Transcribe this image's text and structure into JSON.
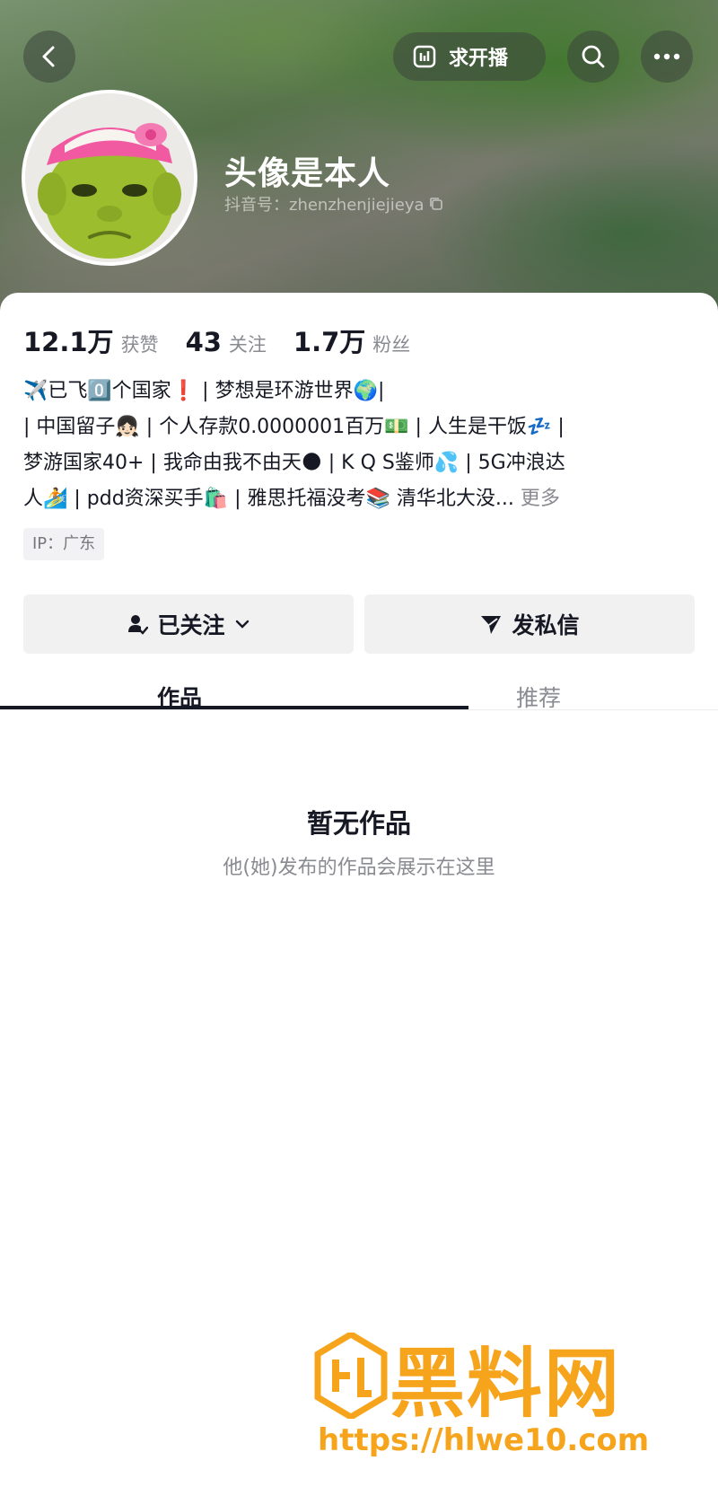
{
  "header": {
    "live_request_label": "求开播",
    "nickname": "头像是本人",
    "douyin_id": "抖音号：zhenzhenjiejieya"
  },
  "stats": [
    {
      "value": "12.1万",
      "label": "获赞"
    },
    {
      "value": "43",
      "label": "关注"
    },
    {
      "value": "1.7万",
      "label": "粉丝"
    }
  ],
  "bio": {
    "lines": [
      "✈️已飞0️⃣个国家❗ | 梦想是环游世界🌍|",
      "| 中国留子👧🏻 | 个人存款0.0000001百万💵 | 人生是干饭💤 |",
      "梦游国家40+ | 我命由我不由天🌑 | K Q S鉴师💦 | 5G冲浪达",
      "人🏄 | pdd资深买手🛍️ | 雅思托福没考📚 清华北大没..."
    ],
    "more_label": "更多"
  },
  "ip_tag": "IP：广东",
  "actions": {
    "follow_label": "已关注",
    "message_label": "发私信"
  },
  "tabs": [
    {
      "label": "作品"
    },
    {
      "label": "推荐"
    }
  ],
  "empty_state": {
    "title": "暂无作品",
    "subtitle": "他(她)发布的作品会展示在这里"
  },
  "watermark": {
    "text": "黑料网",
    "url": "https://hlwe10.com"
  }
}
